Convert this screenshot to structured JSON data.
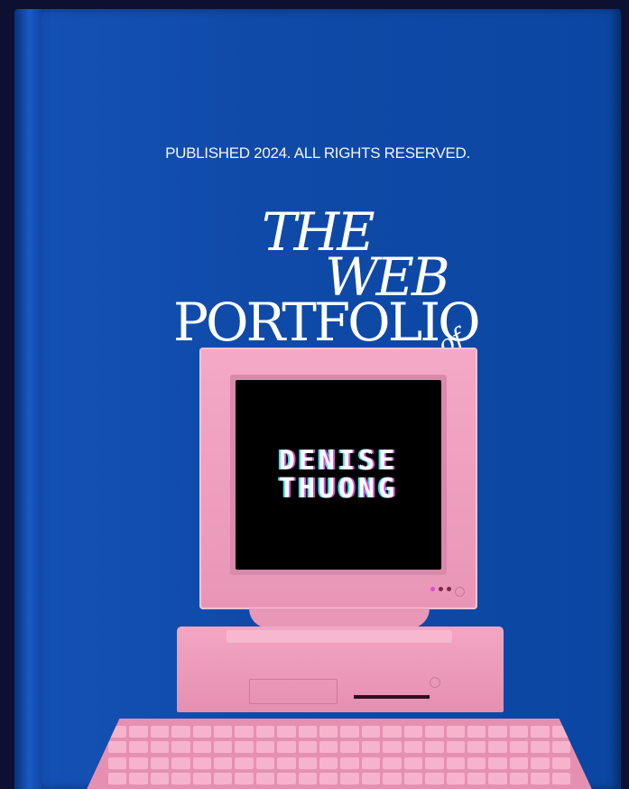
{
  "cover": {
    "published": "PUBLISHED 2024. ALL RIGHTS RESERVED.",
    "title_the": "THE",
    "title_web": "WEB",
    "title_portfolio": "PORTFOLIO",
    "title_of": "of"
  },
  "screen": {
    "first_name": "DENISE",
    "last_name": "THUONG"
  },
  "colors": {
    "cover_blue": "#0f4aa8",
    "computer_pink": "#f4a9c6",
    "screen_black": "#000000"
  }
}
